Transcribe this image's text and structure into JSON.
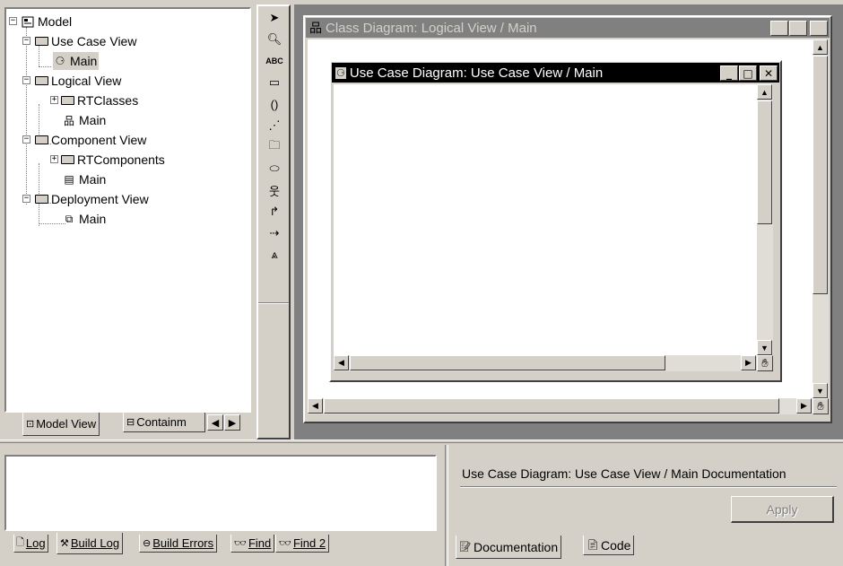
{
  "tree": {
    "root": "Model",
    "use_case_view": "Use Case View",
    "use_case_main": "Main",
    "logical_view": "Logical View",
    "rtclasses": "RTClasses",
    "logical_main": "Main",
    "component_view": "Component View",
    "rtcomponents": "RTComponents",
    "component_main": "Main",
    "deployment_view": "Deployment View",
    "deployment_main": "Main"
  },
  "browser_tabs": {
    "model_view": "Model View",
    "containment": "Containm"
  },
  "toolbox": {
    "text_tool": "ABC"
  },
  "class_diagram": {
    "title": "Class Diagram: Logical View / Main"
  },
  "use_case_diagram": {
    "title": "Use Case Diagram: Use Case View / Main"
  },
  "output_tabs": {
    "log": "Log",
    "build_log": "Build Log",
    "build_errors": "Build Errors",
    "find": "Find",
    "find2": "Find 2"
  },
  "doc_panel": {
    "heading": "Use Case Diagram: Use Case View / Main Documentation",
    "apply": "Apply",
    "tab_documentation": "Documentation",
    "tab_code": "Code"
  },
  "window_buttons": {
    "minimize": "_",
    "maximize": "□",
    "close": "✕"
  }
}
